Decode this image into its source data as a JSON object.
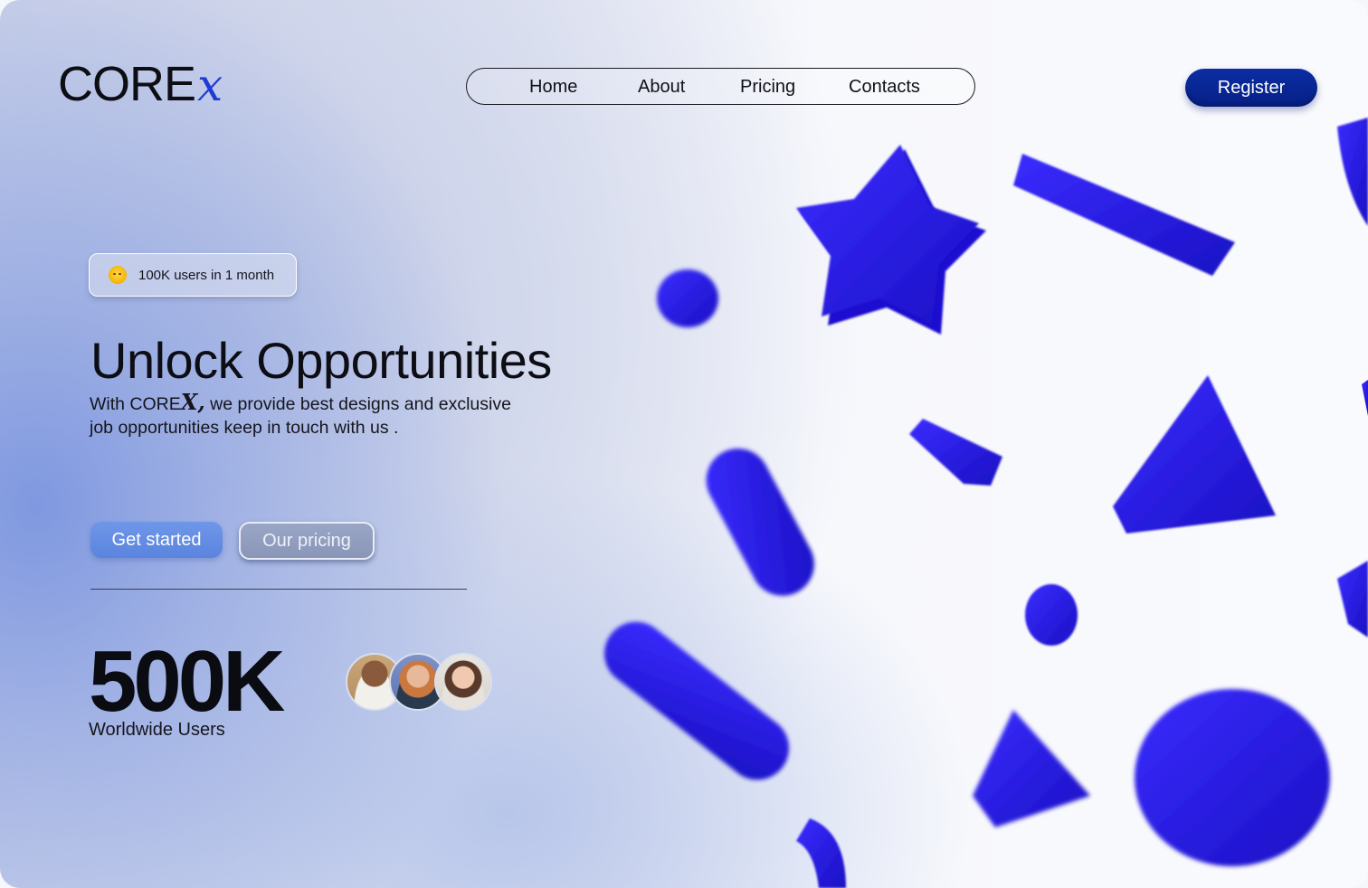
{
  "brand": {
    "name_main": "CORE",
    "name_accent": "x"
  },
  "nav": {
    "items": [
      "Home",
      "About",
      "Pricing",
      "Contacts"
    ]
  },
  "header": {
    "register_label": "Register"
  },
  "badge": {
    "text": "100K users in 1 month",
    "icon": "party-face-emoji"
  },
  "hero": {
    "title": "Unlock Opportunities",
    "text_before": "With CORE",
    "text_brand_x": "X,",
    "text_after": " we provide best designs and exclusive job opportunities keep in touch with us ."
  },
  "actions": {
    "primary_label": "Get started",
    "secondary_label": "Our pricing"
  },
  "stats": {
    "value": "500K",
    "label": "Worldwide Users"
  },
  "colors": {
    "accent": "#1f3bd6",
    "brand_dark": "#061f86",
    "button_primary": "#6a91e6",
    "shape_blue": "#2414e8"
  }
}
